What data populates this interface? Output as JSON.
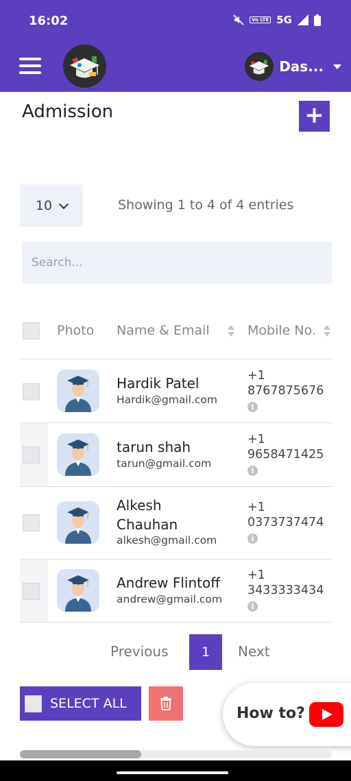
{
  "statusbar": {
    "time": "16:02",
    "network": "5G",
    "volte": "Vo LTE"
  },
  "header": {
    "user_name": "Das..."
  },
  "page": {
    "title": "Admission",
    "add_label": "+"
  },
  "table_controls": {
    "page_length": "10",
    "info": "Showing 1 to 4 of 4 entries",
    "search_placeholder": "Search..."
  },
  "columns": {
    "photo": "Photo",
    "name_email": "Name & Email",
    "mobile": "Mobile No."
  },
  "rows": [
    {
      "name": "Hardik Patel",
      "email": "Hardik@gmail.com",
      "code": "+1",
      "mobile": "8767875676"
    },
    {
      "name": "tarun shah",
      "email": "tarun@gmail.com",
      "code": "+1",
      "mobile": "9658471425"
    },
    {
      "name": "Alkesh Chauhan",
      "email": "alkesh@gmail.com",
      "code": "+1",
      "mobile": "0373737474"
    },
    {
      "name": "Andrew Flintoff",
      "email": "andrew@gmail.com",
      "code": "+1",
      "mobile": "3433333434"
    }
  ],
  "pagination": {
    "previous": "Previous",
    "current": "1",
    "next": "Next"
  },
  "actions": {
    "select_all": "SELECT ALL"
  },
  "help": {
    "label": "How to?"
  },
  "colors": {
    "primary": "#5b3fbf",
    "delete": "#f07272",
    "youtube": "#ff0000"
  },
  "icons": {
    "menu": "hamburger-icon",
    "logo": "graduation-cap-logo",
    "caret": "caret-down-icon",
    "add": "plus-icon",
    "chevron": "chevron-down-icon",
    "sort": "sort-icon",
    "info": "info-icon",
    "trash": "trash-icon",
    "youtube": "youtube-icon"
  }
}
